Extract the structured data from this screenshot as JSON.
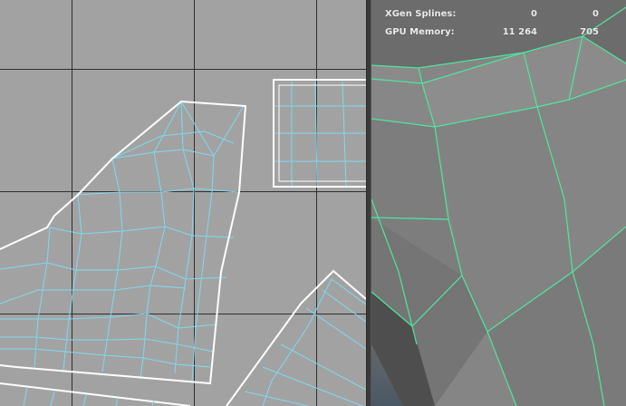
{
  "hud": {
    "rows": [
      {
        "label": "XGen Splines:",
        "value1": "0",
        "value2": "0"
      },
      {
        "label": "GPU Memory:",
        "value1": "11 264",
        "value2": "705"
      }
    ]
  },
  "colors": {
    "uv_background": "#a2a2a2",
    "uv_grid": "#2f2f2f",
    "uv_wire": "#7fd9f0",
    "uv_border": "#ffffff",
    "viewport_background": "#7d7d7d",
    "viewport_wire": "#4fe6a0",
    "hud_text": "#ececec"
  }
}
